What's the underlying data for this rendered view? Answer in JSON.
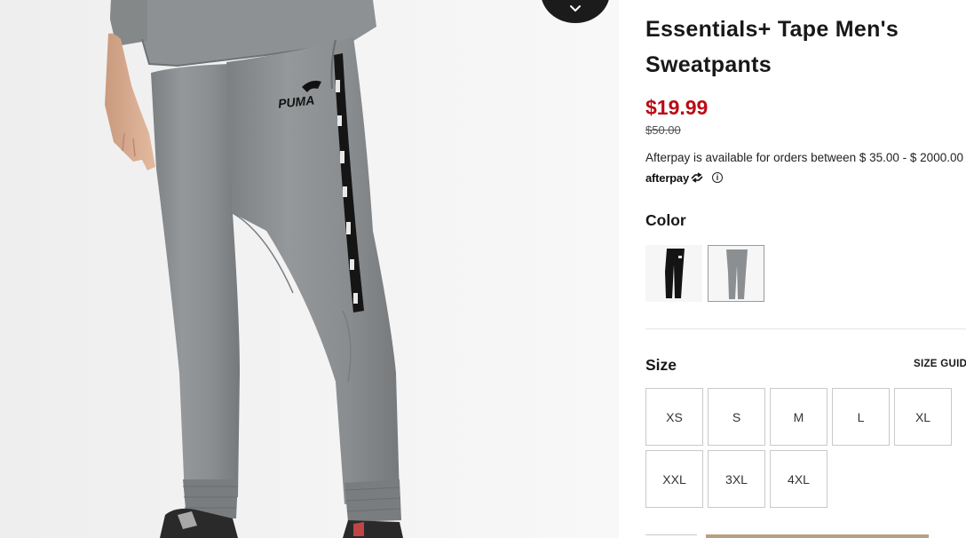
{
  "product": {
    "title": "Essentials+ Tape Men's Sweatpants",
    "price": "$19.99",
    "original_price": "$50.00",
    "afterpay_note": "Afterpay is available for orders between $ 35.00 - $ 2000.00",
    "afterpay_logo": "afterpay",
    "brand_print": "PUMA"
  },
  "color": {
    "label": "Color",
    "swatches": [
      {
        "name": "black",
        "color": "#141414",
        "selected": false
      },
      {
        "name": "grey",
        "color": "#8c8f91",
        "selected": true
      }
    ]
  },
  "size": {
    "label": "Size",
    "guide_label": "SIZE GUIDE",
    "options": [
      "XS",
      "S",
      "M",
      "L",
      "XL",
      "XXL",
      "3XL",
      "4XL"
    ]
  },
  "icons": {
    "scroll": "chevron-down-icon",
    "info": "info-icon",
    "afterpay": "afterpay-arrows-icon"
  },
  "colors": {
    "price_red": "#ba0c16",
    "text": "#181818",
    "pants_grey": "#8c8f91",
    "cart_button": "#b79f80"
  }
}
